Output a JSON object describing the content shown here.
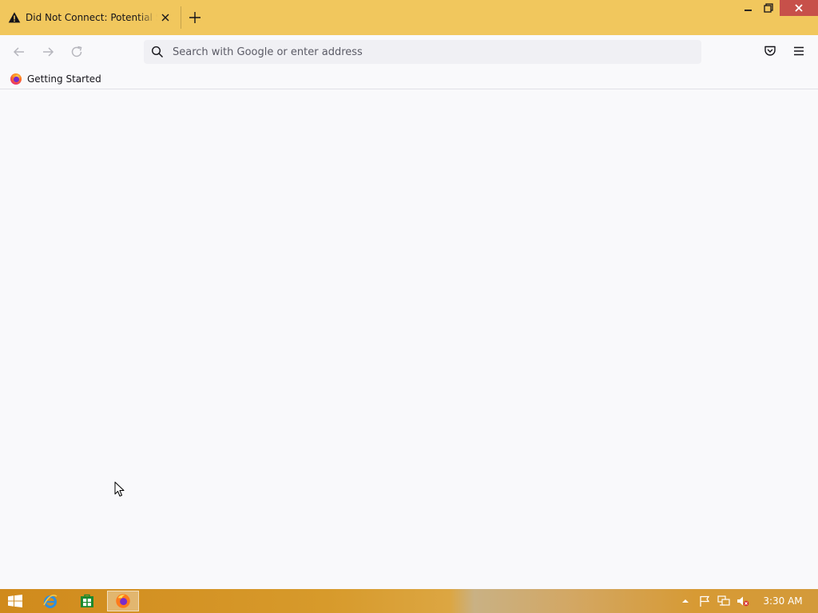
{
  "browser": {
    "tab": {
      "title": "Did Not Connect: Potential Security Issue",
      "icon": "warning-icon"
    },
    "window_controls": [
      "minimize-icon",
      "restore-icon",
      "close-icon"
    ],
    "navigation": {
      "back_icon": "arrow-left-icon",
      "forward_icon": "arrow-right-icon",
      "reload_icon": "reload-icon"
    },
    "urlbar": {
      "placeholder": "Search with Google or enter address",
      "value": ""
    },
    "toolbar_icons": [
      "pocket-icon",
      "hamburger-menu-icon"
    ],
    "bookmarks": [
      {
        "label": "Getting Started",
        "icon": "firefox-icon"
      }
    ]
  },
  "taskbar": {
    "apps": [
      "internet-explorer-icon",
      "store-icon",
      "firefox-icon"
    ],
    "active_app": "firefox-icon",
    "tray_icons": [
      "show-hidden-icons-icon",
      "flag-icon",
      "network-icon",
      "volume-muted-icon"
    ],
    "clock": "3:30 AM"
  },
  "colors": {
    "titlebar": "#f1c75d",
    "close_button": "#c7504a",
    "page_background": "#f9f9fb",
    "urlbar_background": "#f0f0f4"
  }
}
